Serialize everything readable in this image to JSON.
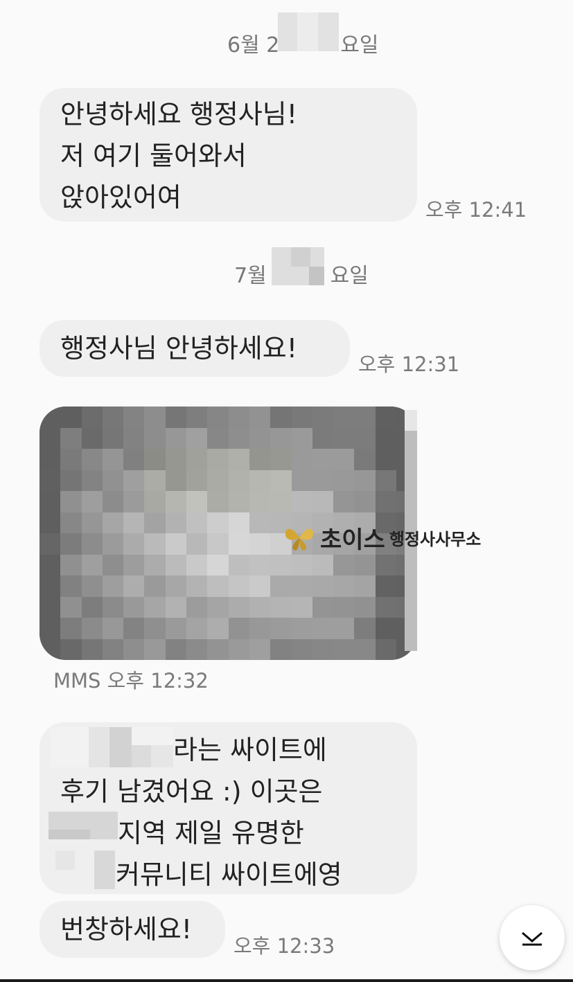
{
  "date_separators": [
    {
      "prefix": "6월 2",
      "suffix": "요일"
    },
    {
      "prefix": "7월",
      "suffix": "요일"
    }
  ],
  "messages": [
    {
      "lines": [
        "안녕하세요 행정사님!",
        "저 여기 둘어와서",
        "앉아있어여"
      ],
      "time": "오후 12:41"
    },
    {
      "lines": [
        "행정사님 안녕하세요!"
      ],
      "time": "오후 12:31"
    },
    {
      "type": "MMS",
      "time": "MMS 오후 12:32"
    },
    {
      "lines": [
        "라는 싸이트에",
        "후기 남겼어요 :) 이곳은",
        "지역 제일 유명한",
        "커뮤니티 싸이트에영"
      ]
    },
    {
      "lines": [
        "번창하세요!"
      ],
      "time": "오후 12:33"
    }
  ],
  "watermark": {
    "brand": "초이스",
    "subtitle": "행정사사무소",
    "logo_icon": "butterfly-icon"
  },
  "scroll_button": {
    "icon": "chevron-down-icon"
  },
  "colors": {
    "background": "#fafafa",
    "bubble": "#efefef",
    "meta_text": "#7a7a7a",
    "message_text": "#222222",
    "logo_gold": "#d4a630"
  }
}
